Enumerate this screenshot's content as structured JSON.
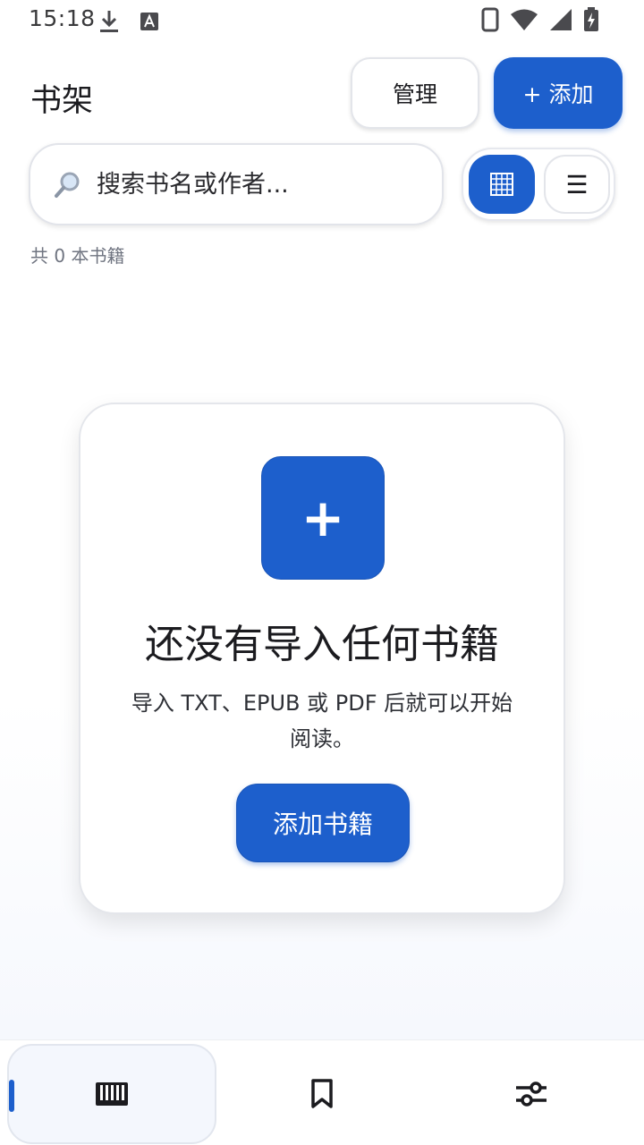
{
  "status_bar": {
    "time": "15:18",
    "left_icons": [
      "download-icon",
      "text-a-icon"
    ],
    "right_icons": [
      "phone-icon",
      "wifi-icon",
      "signal-icon",
      "battery-charging-icon"
    ]
  },
  "header": {
    "title": "书架",
    "manage_label": "管理",
    "add_label": "+ 添加"
  },
  "search": {
    "placeholder": "搜索书名或作者..."
  },
  "view_toggle": {
    "active": "grid",
    "options": [
      "grid-view-icon",
      "list-view-icon"
    ],
    "list_glyph": "☰"
  },
  "library": {
    "count_text": "共 0 本书籍"
  },
  "empty_state": {
    "plus_glyph": "+",
    "title": "还没有导入任何书籍",
    "description": "导入 TXT、EPUB 或 PDF 后就可以开始阅读。",
    "button_label": "添加书籍"
  },
  "bottom_nav": {
    "items": [
      "bookshelf-icon",
      "bookmark-icon",
      "sliders-icon"
    ],
    "active_index": 0
  },
  "colors": {
    "accent": "#1d5fcc",
    "text": "#1b1b1f",
    "muted": "#6f7480"
  }
}
